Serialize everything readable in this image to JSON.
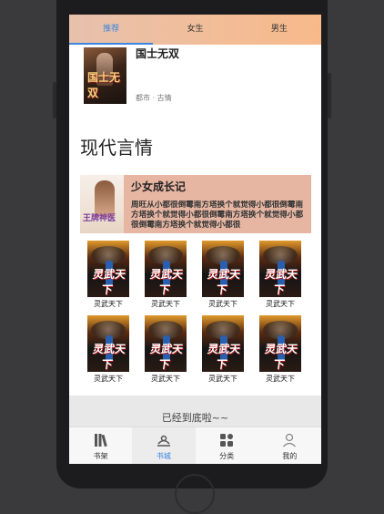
{
  "top_tabs": [
    {
      "label": "推荐",
      "active": true
    },
    {
      "label": "女生",
      "active": false
    },
    {
      "label": "男生",
      "active": false
    }
  ],
  "featured": {
    "title": "国士无双",
    "cover_title": "国士无双",
    "meta": "都市 · 古情"
  },
  "section": {
    "title": "现代言情"
  },
  "highlight": {
    "title": "少女成长记",
    "cover_title": "王牌神医",
    "description": "周旺从小都很倒霉南方塔换个就觉得小都很倒霉南方塔换个就觉得小都很倒霉南方塔换个就觉得小都很倒霉南方塔换个就觉得小都很"
  },
  "grid_books": [
    {
      "label": "灵武天下",
      "cover_title": "灵武天下"
    },
    {
      "label": "灵武天下",
      "cover_title": "灵武天下"
    },
    {
      "label": "灵武天下",
      "cover_title": "灵武天下"
    },
    {
      "label": "灵武天下",
      "cover_title": "灵武天下"
    },
    {
      "label": "灵武天下",
      "cover_title": "灵武天下"
    },
    {
      "label": "灵武天下",
      "cover_title": "灵武天下"
    },
    {
      "label": "灵武天下",
      "cover_title": "灵武天下"
    },
    {
      "label": "灵武天下",
      "cover_title": "灵武天下"
    }
  ],
  "end_text": "已经到底啦~~",
  "bottom_nav": [
    {
      "label": "书架",
      "icon": "bookshelf-icon",
      "active": false
    },
    {
      "label": "书城",
      "icon": "bookstore-icon",
      "active": true
    },
    {
      "label": "分类",
      "icon": "category-icon",
      "active": false
    },
    {
      "label": "我的",
      "icon": "profile-icon",
      "active": false
    }
  ],
  "colors": {
    "accent": "#3a86e0",
    "header_gradient_start": "#e7c1ad",
    "header_gradient_end": "#f7b98a",
    "highlight_card": "#e6b6a3"
  }
}
